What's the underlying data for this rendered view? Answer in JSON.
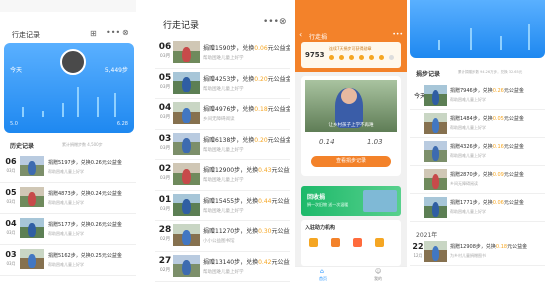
{
  "p1": {
    "title": "行走记录",
    "steps": "5,449步",
    "avatar_label": "今天",
    "section": "历史记录",
    "section_hint": "累计捐赠步数 4,500步",
    "chart_left": "5.0",
    "chart_right": "6.28",
    "rows": [
      {
        "d": "06",
        "m": "03月",
        "t": "捐赠5197步，兑换0.26元公益金",
        "s": "帮助困难儿童上好学"
      },
      {
        "d": "05",
        "m": "03月",
        "t": "捐赠4873步，兑换0.24元公益金",
        "s": "帮助困难儿童上好学"
      },
      {
        "d": "04",
        "m": "03月",
        "t": "捐赠5177步，兑换0.26元公益金",
        "s": "帮助困难儿童上好学"
      },
      {
        "d": "03",
        "m": "03月",
        "t": "捐赠5162步，兑换0.25元公益金",
        "s": "帮助困难儿童上好学"
      }
    ]
  },
  "p2": {
    "title": "行走记录",
    "rows": [
      {
        "d": "06",
        "m": "03月",
        "pre": "捐赠1590步，兑换",
        "amt": "0.06",
        "suf": "元公益金",
        "s": "帮助困难儿童上好学"
      },
      {
        "d": "05",
        "m": "03月",
        "pre": "捐赠4253步，兑换",
        "amt": "0.20",
        "suf": "元公益金",
        "s": "帮助困难儿童上好学"
      },
      {
        "d": "04",
        "m": "03月",
        "pre": "捐赠4976步，兑换",
        "amt": "0.18",
        "suf": "元公益金",
        "s": "乡间无障碍阅读"
      },
      {
        "d": "03",
        "m": "03月",
        "pre": "捐赠6138步，兑换",
        "amt": "0.20",
        "suf": "元公益金",
        "s": "帮助困难儿童上好学"
      },
      {
        "d": "02",
        "m": "03月",
        "pre": "捐赠12900步，兑换",
        "amt": "0.43",
        "suf": "元公益金",
        "s": "帮助困难儿童上好学"
      },
      {
        "d": "01",
        "m": "03月",
        "pre": "捐赠15455步，兑换",
        "amt": "0.44",
        "suf": "元公益金",
        "s": "帮助困难儿童上好学"
      },
      {
        "d": "28",
        "m": "02月",
        "pre": "捐赠11270步，兑换",
        "amt": "0.30",
        "suf": "元公益金",
        "s": "小小公益图书馆"
      },
      {
        "d": "27",
        "m": "02月",
        "pre": "捐赠13140步，兑换",
        "amt": "0.42",
        "suf": "元公益金",
        "s": "帮助困难儿童上好学"
      }
    ]
  },
  "p3": {
    "title": "行走捐",
    "banner_text": "连续7天捐步可获得勋章",
    "steps": "9753",
    "scene_caption": "让乡村孩子上学不再难",
    "v1": "0.14",
    "v2": "1.03",
    "button": "查看捐步记录",
    "promo_title": "回收捐",
    "promo_sub": "捐一次旧物 送一次温暖",
    "section": "入驻助力机构",
    "nav_home": "首页",
    "nav_mine": "我的"
  },
  "p4": {
    "section": "捐步记录",
    "section_hint": "累计捐赠步数 94.26万步，兑换 32.65元",
    "today": "今天",
    "year": "2021年",
    "rows": [
      {
        "d": "",
        "m": "",
        "pre": "捐赠7946步，兑换",
        "amt": "0.26",
        "suf": "元公益金",
        "s": "帮助困难儿童上好学"
      },
      {
        "d": "",
        "m": "",
        "pre": "捐赠1484步，兑换",
        "amt": "0.05",
        "suf": "元公益金",
        "s": "帮助困难儿童上好学"
      },
      {
        "d": "",
        "m": "",
        "pre": "捐赠4326步，兑换",
        "amt": "0.16",
        "suf": "元公益金",
        "s": "帮助困难儿童上好学"
      },
      {
        "d": "",
        "m": "",
        "pre": "捐赠2870步，兑换",
        "amt": "0.09",
        "suf": "元公益金",
        "s": "乡间无障碍阅读"
      },
      {
        "d": "",
        "m": "",
        "pre": "捐赠1771步，兑换",
        "amt": "0.06",
        "suf": "元公益金",
        "s": "帮助困难儿童上好学"
      },
      {
        "d": "22",
        "m": "12月",
        "pre": "捐赠12908步，兑换",
        "amt": "0.18",
        "suf": "元公益金",
        "s": "为乡村儿童捐赠图书"
      }
    ]
  },
  "colors": {
    "blue": "#1e90ff",
    "orange": "#f5a623",
    "header_orange": "#f3822a"
  }
}
